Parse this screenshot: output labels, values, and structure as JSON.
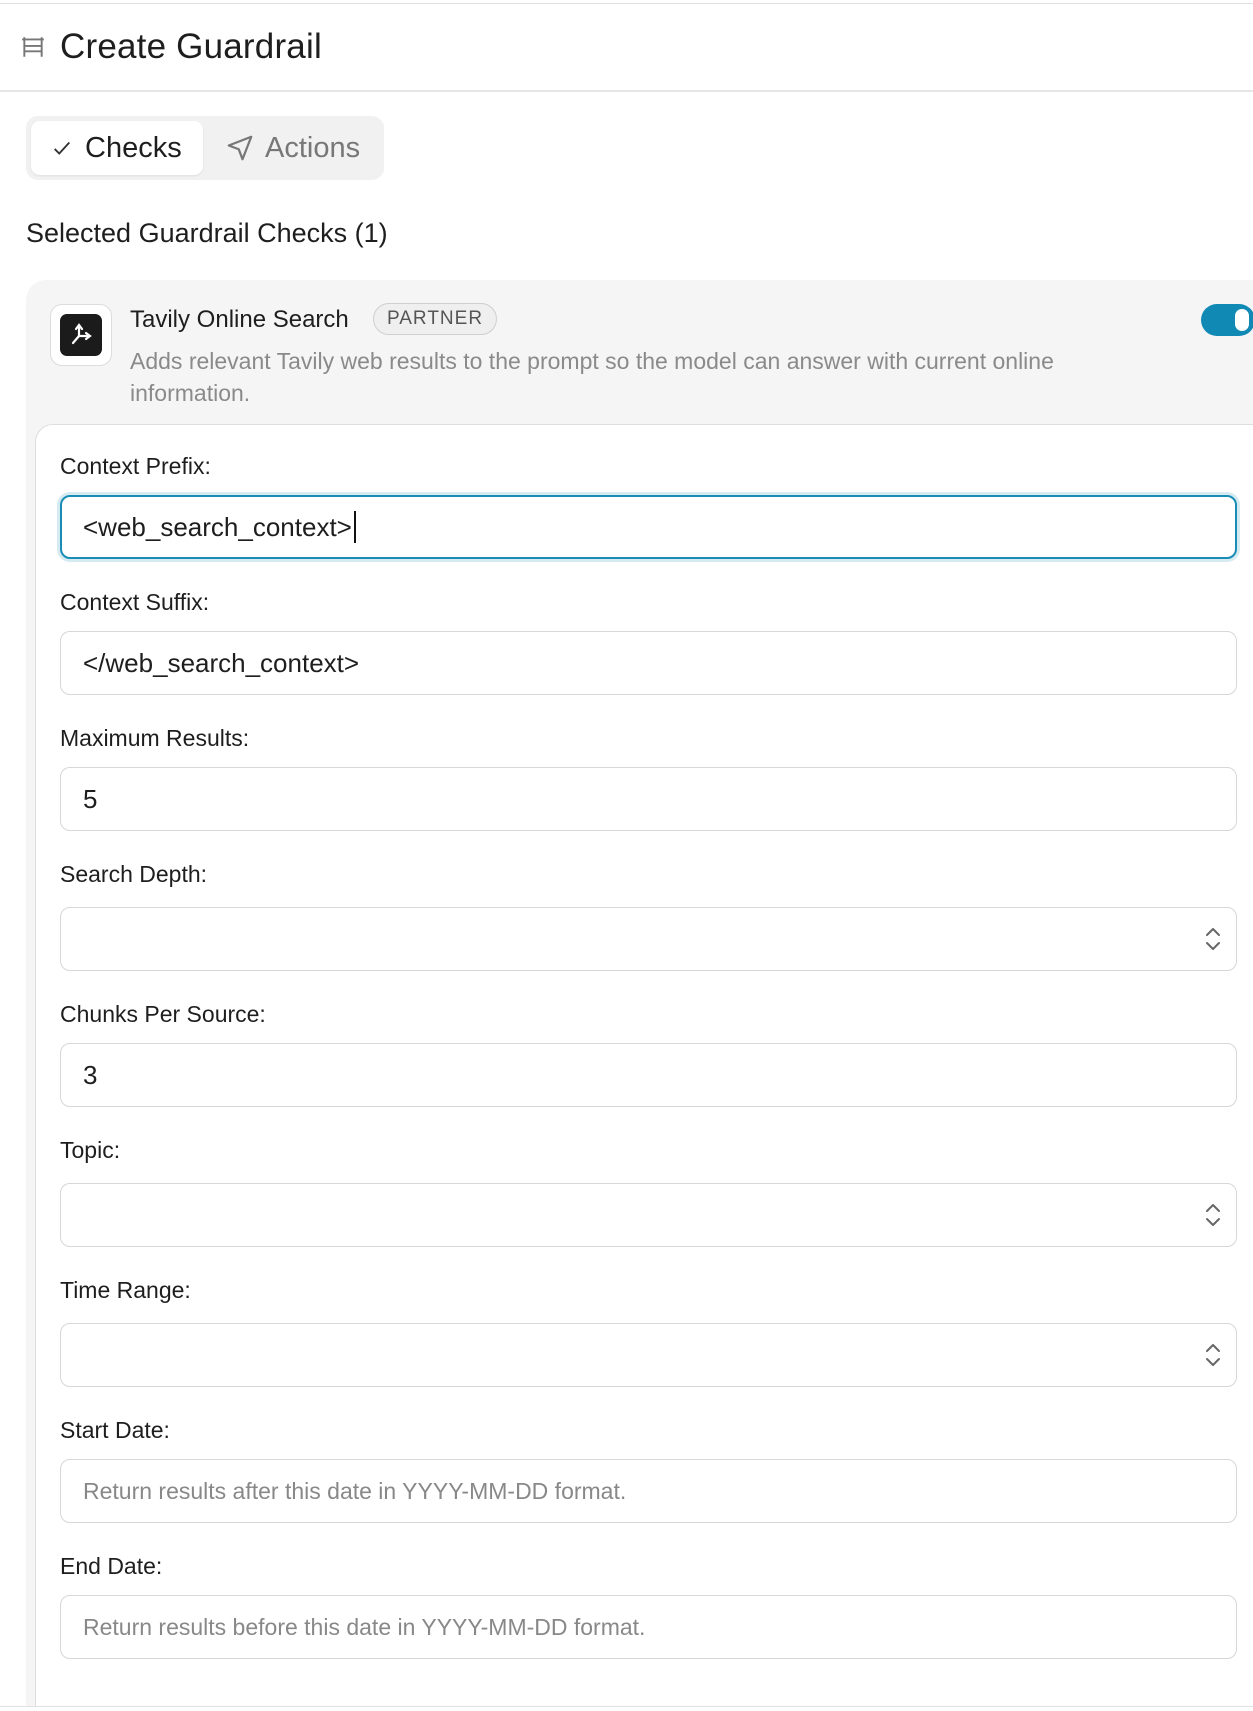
{
  "header": {
    "title": "Create Guardrail",
    "icon": "guardrail-icon"
  },
  "tabs": [
    {
      "label": "Checks",
      "icon": "check-icon",
      "active": true
    },
    {
      "label": "Actions",
      "icon": "send-icon",
      "active": false
    }
  ],
  "section": {
    "title": "Selected Guardrail Checks (1)"
  },
  "check": {
    "name": "Tavily Online Search",
    "badge": "PARTNER",
    "description": "Adds relevant Tavily web results to the prompt so the model can answer with current online information.",
    "enabled": true,
    "logo_icon": "tavily-logo-icon",
    "accent_color": "#1189b5"
  },
  "form": {
    "context_prefix": {
      "label": "Context Prefix:",
      "value": "<web_search_context>"
    },
    "context_suffix": {
      "label": "Context Suffix:",
      "value": "</web_search_context>"
    },
    "max_results": {
      "label": "Maximum Results:",
      "value": "5"
    },
    "search_depth": {
      "label": "Search Depth:",
      "value": ""
    },
    "chunks_per_source": {
      "label": "Chunks Per Source:",
      "value": "3"
    },
    "topic": {
      "label": "Topic:",
      "value": ""
    },
    "time_range": {
      "label": "Time Range:",
      "value": ""
    },
    "start_date": {
      "label": "Start Date:",
      "placeholder": "Return results after this date in YYYY-MM-DD format."
    },
    "end_date": {
      "label": "End Date:",
      "placeholder": "Return results before this date in YYYY-MM-DD format."
    }
  }
}
